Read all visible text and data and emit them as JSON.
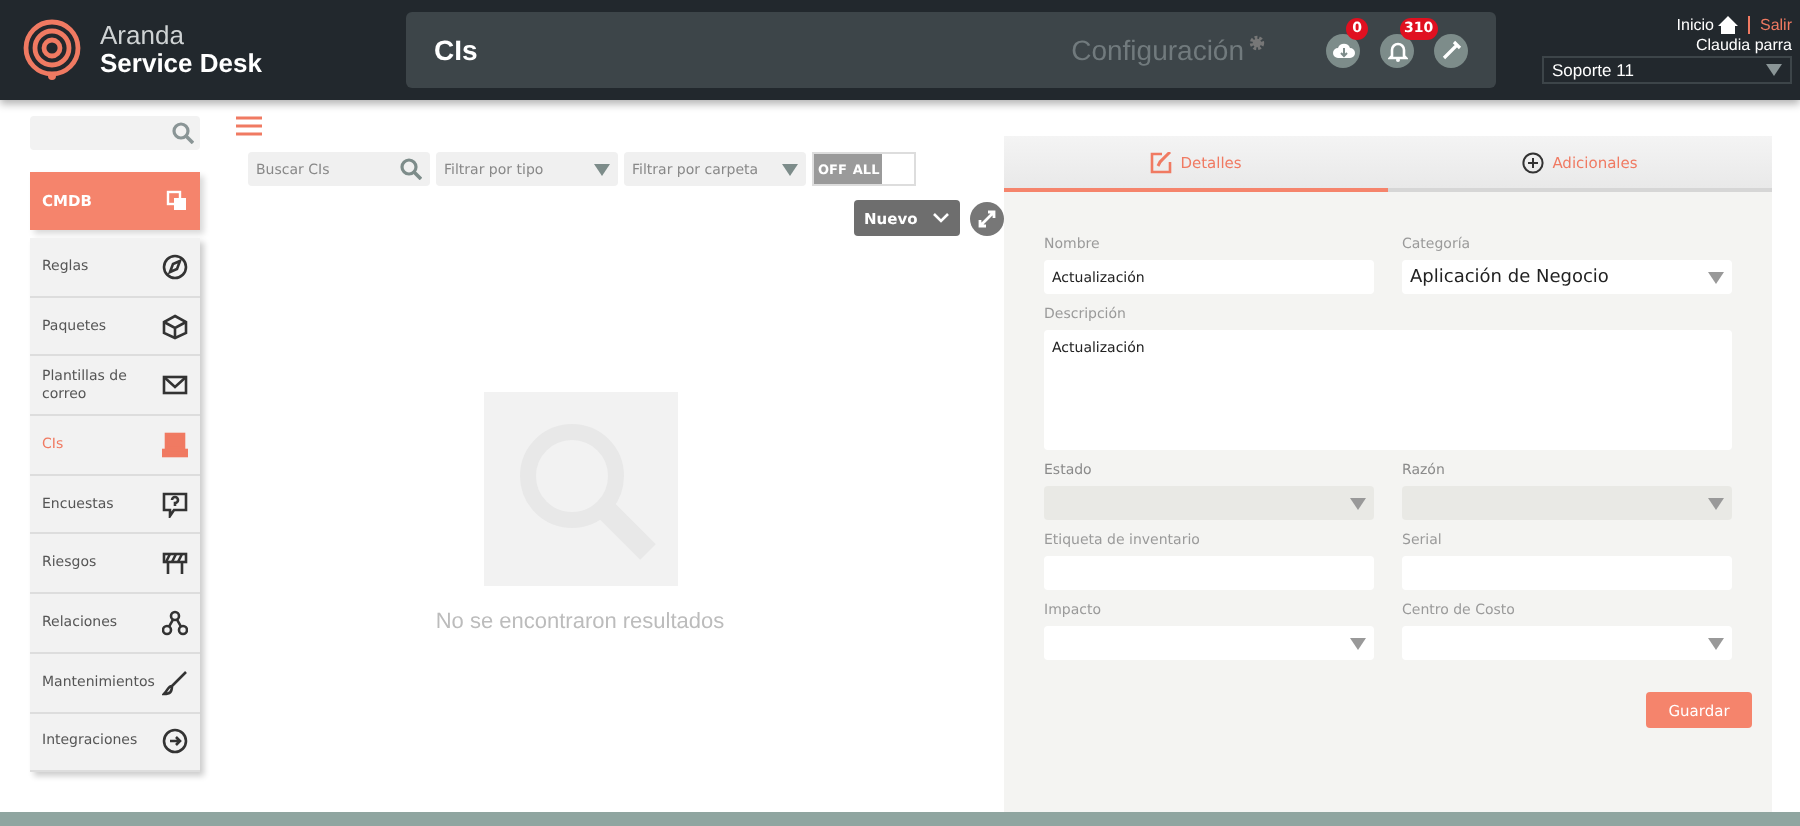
{
  "brand": {
    "line1": "Aranda",
    "line2": "Service Desk"
  },
  "header": {
    "title": "CIs",
    "section": "Configuración",
    "notifications": [
      {
        "kind": "cloud",
        "count": "0"
      },
      {
        "kind": "bell",
        "count": "310"
      },
      {
        "kind": "tools"
      }
    ],
    "user": {
      "home": "Inicio",
      "logout": "Salir",
      "name": "Claudia parra",
      "project": "Soporte 11"
    }
  },
  "sidebar": {
    "header": "CMDB",
    "items": [
      {
        "label": "Reglas",
        "selected": false
      },
      {
        "label": "Paquetes",
        "selected": false
      },
      {
        "label": "Plantillas de correo",
        "selected": false
      },
      {
        "label": "CIs",
        "selected": true
      },
      {
        "label": "Encuestas",
        "selected": false
      },
      {
        "label": "Riesgos",
        "selected": false
      },
      {
        "label": "Relaciones",
        "selected": false
      },
      {
        "label": "Mantenimientos",
        "selected": false
      },
      {
        "label": "Integraciones",
        "selected": false
      }
    ]
  },
  "list": {
    "search": {
      "placeholder": "Buscar CIs"
    },
    "filters": [
      {
        "placeholder": "Filtrar por tipo"
      },
      {
        "placeholder": "Filtrar por carpeta"
      }
    ],
    "toggle": {
      "off_label": "OFF",
      "all_label": "ALL",
      "on": false
    },
    "new_button": "Nuevo",
    "empty_message": "No se encontraron resultados"
  },
  "detail": {
    "tabs": [
      {
        "label": "Detalles",
        "selected": true
      },
      {
        "label": "Adicionales",
        "selected": false
      }
    ],
    "fields": [
      {
        "label": "Nombre",
        "kind": "text",
        "value": "Actualización",
        "disabled": false
      },
      {
        "label": "Categoría",
        "kind": "select",
        "value": "Aplicación de Negocio",
        "disabled": false
      },
      {
        "label": "Descripción",
        "kind": "textarea",
        "value": "Actualización",
        "disabled": false
      },
      {
        "label": "Estado",
        "kind": "select",
        "disabled": true
      },
      {
        "label": "Razón",
        "kind": "select",
        "disabled": true
      },
      {
        "label": "Etiqueta de inventario",
        "kind": "text",
        "disabled": false
      },
      {
        "label": "Serial",
        "kind": "text",
        "disabled": false
      },
      {
        "label": "Impacto",
        "kind": "select",
        "disabled": false
      },
      {
        "label": "Centro de Costo",
        "kind": "select",
        "disabled": false
      }
    ],
    "save_button": "Guardar"
  }
}
